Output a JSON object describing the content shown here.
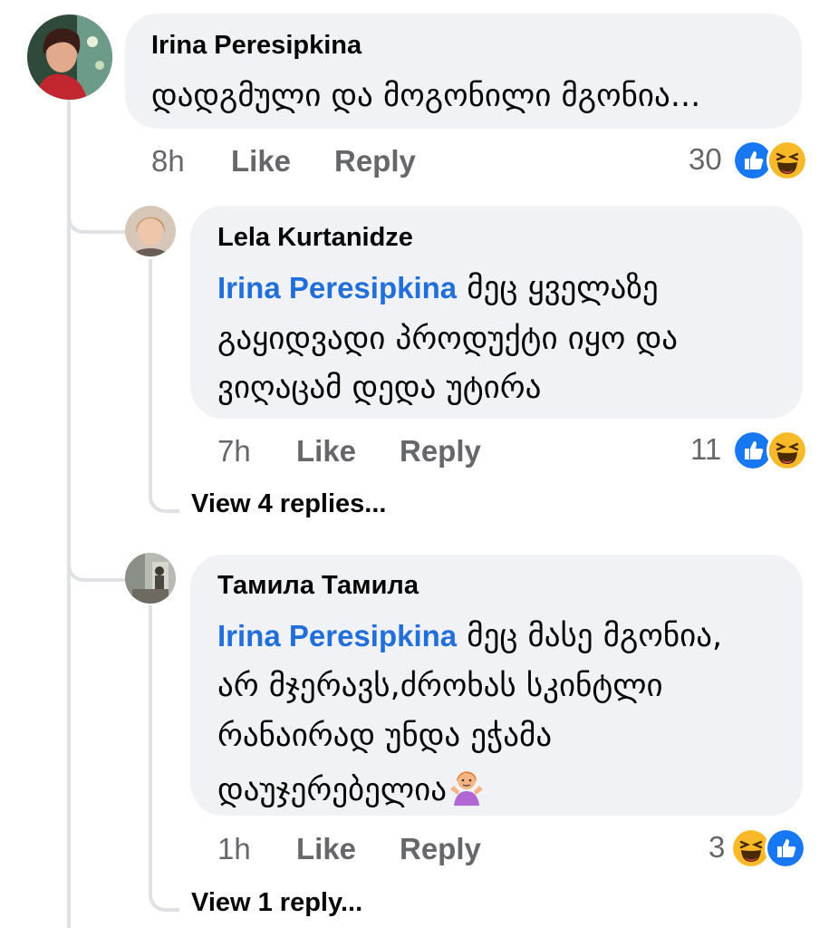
{
  "comments": [
    {
      "author": "Irina Peresipkina",
      "lines": [
        "დადგმული და მოგონილი მგონია..."
      ],
      "time": "8h",
      "like_label": "Like",
      "reply_label": "Reply",
      "reaction_count": "30",
      "reactions": [
        "like-icon",
        "haha-icon"
      ]
    },
    {
      "author": "Lela Kurtanidze",
      "mention": "Irina Peresipkina",
      "lines": [
        "მეც ყველაზე",
        "გაყიდვადი პროდუქტი იყო და",
        "ვიღაცამ დედა უტირა"
      ],
      "time": "7h",
      "like_label": "Like",
      "reply_label": "Reply",
      "reaction_count": "11",
      "reactions": [
        "like-icon",
        "haha-icon"
      ],
      "view_replies": "View 4 replies..."
    },
    {
      "author": "Тамила Тамила",
      "mention": "Irina Peresipkina",
      "lines": [
        "მეც მასე მგონია,",
        "არ მჯერავს,ძროხას სკინტლი",
        "რანაირად უნდა ეჭამა",
        "დაუჯერებელია"
      ],
      "trailing_emoji": "person-shrugging-emoji",
      "time": "1h",
      "like_label": "Like",
      "reply_label": "Reply",
      "reaction_count": "3",
      "reactions": [
        "haha-icon",
        "like-icon"
      ],
      "view_replies": "View 1 reply..."
    }
  ],
  "colors": {
    "bubble": "#f0f2f5",
    "mention": "#216fdb",
    "meta": "#65676b",
    "like_blue": "#1877f2",
    "haha_yellow": "#f7b928"
  }
}
